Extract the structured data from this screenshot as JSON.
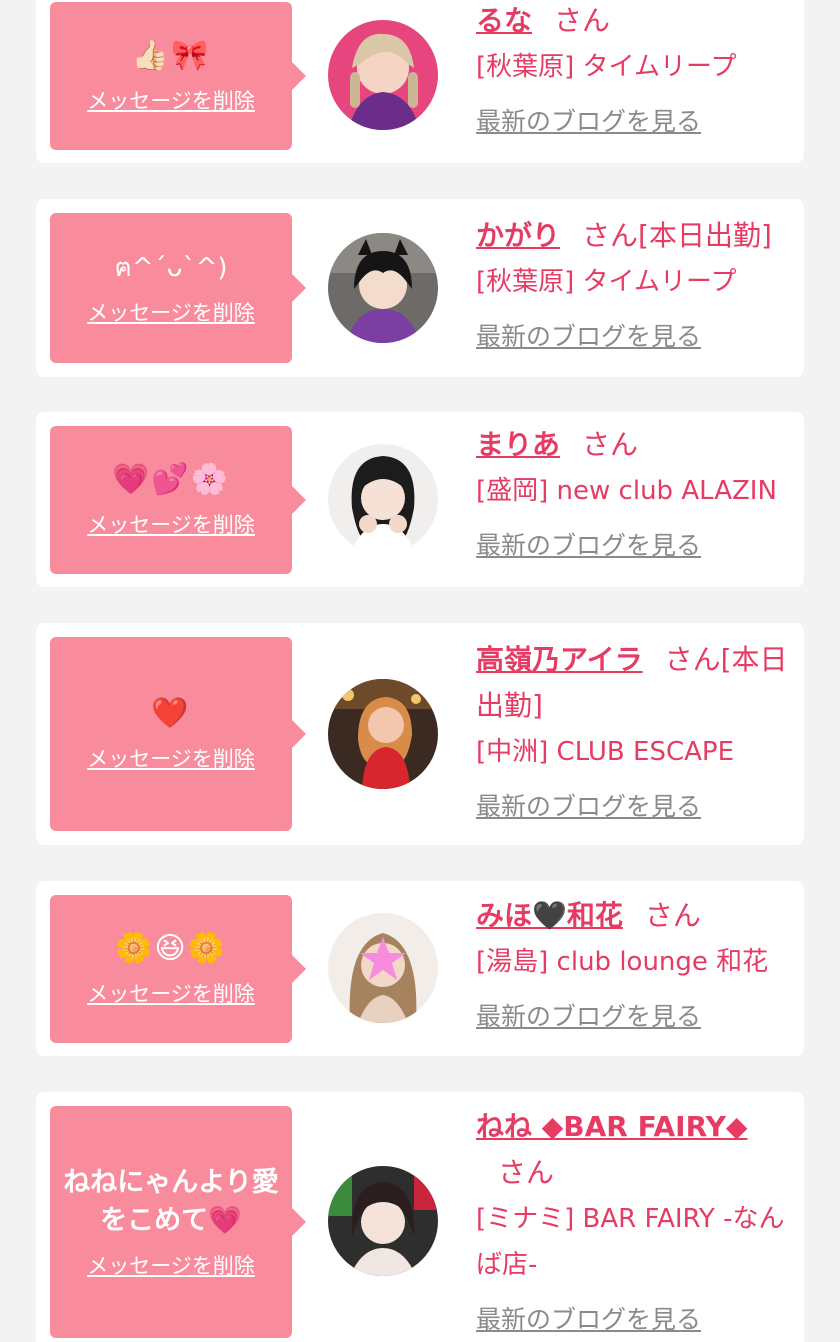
{
  "favorites": [
    {
      "message": "👍🏻🎀",
      "delete_label": "メッセージを削除",
      "name": "るな",
      "honorific": "さん",
      "status": "",
      "store": "[秋葉原] タイムリープ",
      "blog_label": "最新のブログを見る"
    },
    {
      "message": "ฅ^ˊᴗˋ^)",
      "delete_label": "メッセージを削除",
      "name": "かがり",
      "honorific": "さん",
      "status": "[本日出勤]",
      "store": "[秋葉原] タイムリープ",
      "blog_label": "最新のブログを見る"
    },
    {
      "message": "💗💕🌸",
      "delete_label": "メッセージを削除",
      "name": "まりあ",
      "honorific": "さん",
      "status": "",
      "store": "[盛岡] new club ALAZIN",
      "blog_label": "最新のブログを見る"
    },
    {
      "message": "❤️",
      "delete_label": "メッセージを削除",
      "name": "高嶺乃アイラ",
      "honorific": "さん",
      "status": "[本日出勤]",
      "store": "[中洲] CLUB ESCAPE",
      "blog_label": "最新のブログを見る"
    },
    {
      "message": "🌼😆🌼",
      "delete_label": "メッセージを削除",
      "name": "みほ🖤和花",
      "honorific": "さん",
      "status": "",
      "store": "[湯島] club lounge 和花",
      "blog_label": "最新のブログを見る"
    },
    {
      "message": "ねねにゃんより愛をこめて💗",
      "delete_label": "メッセージを削除",
      "name": "ねね ◆BAR FAIRY◆",
      "honorific": "さん",
      "status": "",
      "store": "[ミナミ] BAR FAIRY -なんば店-",
      "blog_label": "最新のブログを見る"
    }
  ],
  "colors": {
    "accent": "#e63b63",
    "bubble": "#f88c9c",
    "background": "#f3f3f3",
    "link_gray": "#8a8a8a"
  }
}
